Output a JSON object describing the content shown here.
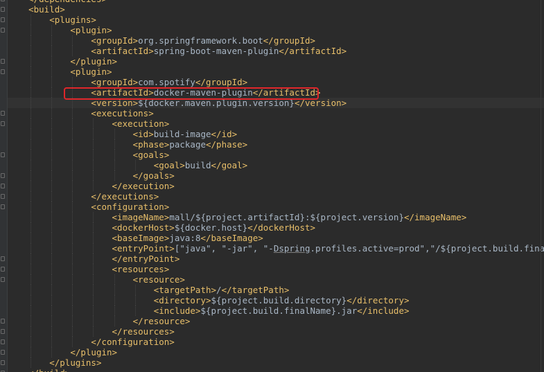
{
  "editor": {
    "indent_unit": 4,
    "lines": [
      {
        "indent": 1,
        "parts": [
          [
            "tag",
            "</dependencies>"
          ]
        ]
      },
      {
        "indent": 1,
        "parts": [
          [
            "tag",
            "<build>"
          ]
        ]
      },
      {
        "indent": 2,
        "parts": [
          [
            "tag",
            "<plugins>"
          ]
        ]
      },
      {
        "indent": 3,
        "parts": [
          [
            "tag",
            "<plugin>"
          ]
        ]
      },
      {
        "indent": 4,
        "parts": [
          [
            "tag",
            "<groupId>"
          ],
          [
            "text",
            "org.springframework.boot"
          ],
          [
            "tag",
            "</groupId>"
          ]
        ]
      },
      {
        "indent": 4,
        "parts": [
          [
            "tag",
            "<artifactId>"
          ],
          [
            "text",
            "spring-boot-maven-plugin"
          ],
          [
            "tag",
            "</artifactId>"
          ]
        ]
      },
      {
        "indent": 3,
        "parts": [
          [
            "tag",
            "</plugin>"
          ]
        ]
      },
      {
        "indent": 3,
        "parts": [
          [
            "tag",
            "<plugin>"
          ]
        ]
      },
      {
        "indent": 4,
        "parts": [
          [
            "tag",
            "<groupId>"
          ],
          [
            "text",
            "com.spotify"
          ],
          [
            "tag",
            "</groupId>"
          ]
        ]
      },
      {
        "indent": 4,
        "highlighted": true,
        "parts": [
          [
            "tag",
            "<artifactId>"
          ],
          [
            "text",
            "docker-maven-plugin"
          ],
          [
            "tag",
            "</artifactId>"
          ]
        ]
      },
      {
        "indent": 4,
        "caret": true,
        "parts": [
          [
            "tag",
            "<version>"
          ],
          [
            "text",
            "${docker.maven.plugin.version}"
          ],
          [
            "tag",
            "</version>"
          ]
        ]
      },
      {
        "indent": 4,
        "parts": [
          [
            "tag",
            "<executions>"
          ]
        ]
      },
      {
        "indent": 5,
        "parts": [
          [
            "tag",
            "<execution>"
          ]
        ]
      },
      {
        "indent": 6,
        "parts": [
          [
            "tag",
            "<id>"
          ],
          [
            "text",
            "build-image"
          ],
          [
            "tag",
            "</id>"
          ]
        ]
      },
      {
        "indent": 6,
        "parts": [
          [
            "tag",
            "<phase>"
          ],
          [
            "text",
            "package"
          ],
          [
            "tag",
            "</phase>"
          ]
        ]
      },
      {
        "indent": 6,
        "parts": [
          [
            "tag",
            "<goals>"
          ]
        ]
      },
      {
        "indent": 7,
        "parts": [
          [
            "tag",
            "<goal>"
          ],
          [
            "text",
            "build"
          ],
          [
            "tag",
            "</goal>"
          ]
        ]
      },
      {
        "indent": 6,
        "parts": [
          [
            "tag",
            "</goals>"
          ]
        ]
      },
      {
        "indent": 5,
        "parts": [
          [
            "tag",
            "</execution>"
          ]
        ]
      },
      {
        "indent": 4,
        "parts": [
          [
            "tag",
            "</executions>"
          ]
        ]
      },
      {
        "indent": 4,
        "parts": [
          [
            "tag",
            "<configuration>"
          ]
        ]
      },
      {
        "indent": 5,
        "parts": [
          [
            "tag",
            "<imageName>"
          ],
          [
            "text",
            "mall/${project.artifactId}:${project.version}"
          ],
          [
            "tag",
            "</imageName>"
          ]
        ]
      },
      {
        "indent": 5,
        "parts": [
          [
            "tag",
            "<dockerHost>"
          ],
          [
            "text",
            "${docker.host}"
          ],
          [
            "tag",
            "</dockerHost>"
          ]
        ]
      },
      {
        "indent": 5,
        "parts": [
          [
            "tag",
            "<baseImage>"
          ],
          [
            "text",
            "java:8"
          ],
          [
            "tag",
            "</baseImage>"
          ]
        ]
      },
      {
        "indent": 5,
        "parts": [
          [
            "tag",
            "<entryPoint>"
          ],
          [
            "text",
            "[\"java\", \"-jar\", \"-"
          ],
          [
            "underline",
            "Dspring"
          ],
          [
            "text",
            ".profiles.active=prod\",\"/${project.build.finalName}.j"
          ]
        ]
      },
      {
        "indent": 5,
        "parts": [
          [
            "tag",
            "</entryPoint>"
          ]
        ]
      },
      {
        "indent": 5,
        "parts": [
          [
            "tag",
            "<resources>"
          ]
        ]
      },
      {
        "indent": 6,
        "parts": [
          [
            "tag",
            "<resource>"
          ]
        ]
      },
      {
        "indent": 7,
        "parts": [
          [
            "tag",
            "<targetPath>"
          ],
          [
            "text",
            "/"
          ],
          [
            "tag",
            "</targetPath>"
          ]
        ]
      },
      {
        "indent": 7,
        "parts": [
          [
            "tag",
            "<directory>"
          ],
          [
            "text",
            "${project.build.directory}"
          ],
          [
            "tag",
            "</directory>"
          ]
        ]
      },
      {
        "indent": 7,
        "parts": [
          [
            "tag",
            "<include>"
          ],
          [
            "text",
            "${project.build.finalName}.jar"
          ],
          [
            "tag",
            "</include>"
          ]
        ]
      },
      {
        "indent": 6,
        "parts": [
          [
            "tag",
            "</resource>"
          ]
        ]
      },
      {
        "indent": 5,
        "parts": [
          [
            "tag",
            "</resources>"
          ]
        ]
      },
      {
        "indent": 4,
        "parts": [
          [
            "tag",
            "</configuration>"
          ]
        ]
      },
      {
        "indent": 3,
        "parts": [
          [
            "tag",
            "</plugin>"
          ]
        ]
      },
      {
        "indent": 2,
        "parts": [
          [
            "tag",
            "</plugins>"
          ]
        ]
      },
      {
        "indent": 1,
        "parts": [
          [
            "tag",
            "</build>"
          ]
        ]
      }
    ],
    "colors": {
      "background": "#2b2b2b",
      "tag": "#e8bf6a",
      "text": "#a9b7c6",
      "highlight_box": "#e0262a"
    }
  }
}
